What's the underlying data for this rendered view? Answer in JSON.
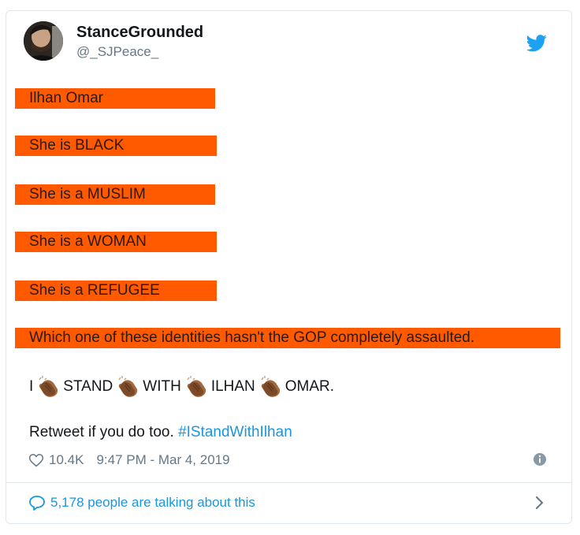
{
  "tweet": {
    "display_name": "StanceGrounded",
    "handle": "@_SJPeace_",
    "highlight_lines": [
      "Ilhan Omar",
      "She is BLACK",
      "She is a MUSLIM",
      "She is a WOMAN",
      "She is a REFUGEE",
      "Which one of these identities hasn't the GOP completely assaulted."
    ],
    "clap_words": [
      "I",
      "STAND",
      "WITH",
      "ILHAN",
      "OMAR."
    ],
    "retweet_text": "Retweet if you do too.",
    "hashtag": "#IStandWithIlhan",
    "likes": "10.4K",
    "timestamp": "9:47 PM - Mar 4, 2019",
    "footer_text": "5,178 people are talking about this"
  },
  "colors": {
    "highlight": "#ff5a00",
    "link": "#1b95e0",
    "secondary_text": "#657786",
    "border": "#e1e8ed"
  },
  "icons": {
    "brand": "twitter-bird-icon",
    "clap": "clapping-hands-emoji",
    "like": "heart-icon",
    "info": "info-icon",
    "reply": "speech-bubble-icon",
    "more": "chevron-right-icon"
  }
}
